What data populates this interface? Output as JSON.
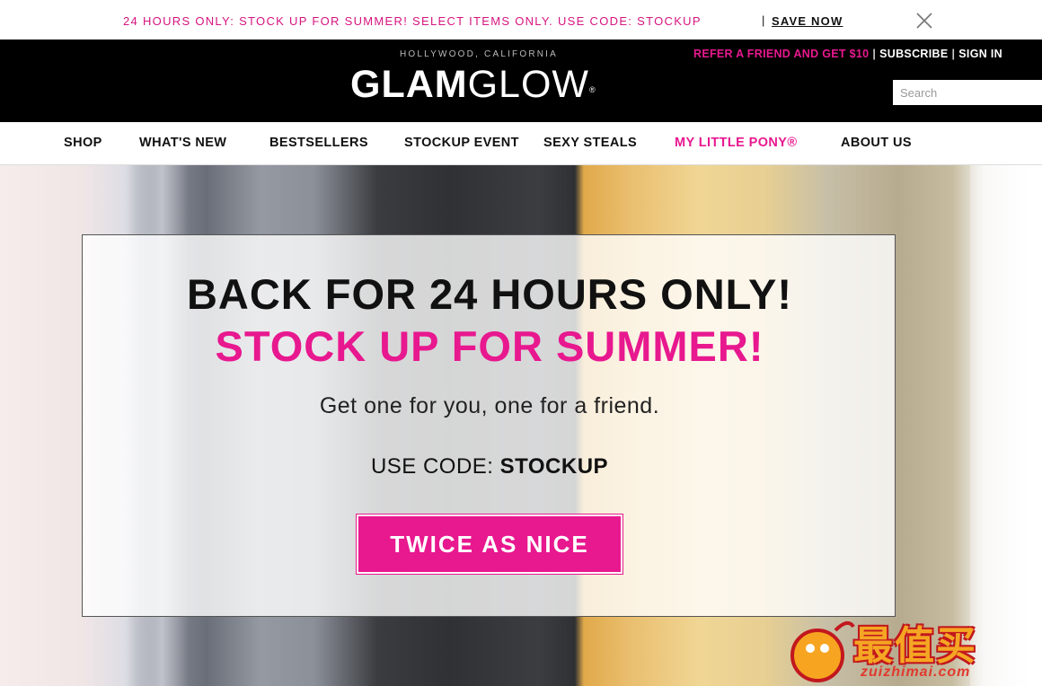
{
  "promo_bar": {
    "text": "24 HOURS ONLY: STOCK UP FOR SUMMER! SELECT ITEMS ONLY. USE CODE: STOCKUP",
    "separator": "|",
    "link_label": "SAVE NOW",
    "close_icon": "close-icon"
  },
  "header": {
    "tagline": "HOLLYWOOD, CALIFORNIA",
    "logo_bold": "GLAM",
    "logo_light": "GLOW",
    "logo_mark": "®",
    "refer_label": "REFER A FRIEND AND GET $10",
    "subscribe_label": "SUBSCRIBE",
    "signin_label": "SIGN IN",
    "search_placeholder": "Search"
  },
  "nav": {
    "items": [
      {
        "label": "SHOP"
      },
      {
        "label": "WHAT'S NEW"
      },
      {
        "label": "BESTSELLERS"
      },
      {
        "label": "STOCKUP EVENT"
      },
      {
        "label": "SEXY STEALS"
      },
      {
        "label": "MY LITTLE PONY®"
      },
      {
        "label": "ABOUT US"
      }
    ]
  },
  "hero": {
    "headline": "BACK FOR 24 HOURS ONLY!",
    "headline_accent": "STOCK UP FOR SUMMER!",
    "subtext": "Get one for you, one for a friend.",
    "code_prefix": "USE CODE: ",
    "code_value": "STOCKUP",
    "cta_label": "TWICE AS NICE"
  },
  "watermark": {
    "chinese": "最值买",
    "domain": "zuizhimai.com"
  },
  "colors": {
    "brand_pink": "#e8188f",
    "promo_pink": "#d6147f",
    "header_bg": "#000000"
  }
}
